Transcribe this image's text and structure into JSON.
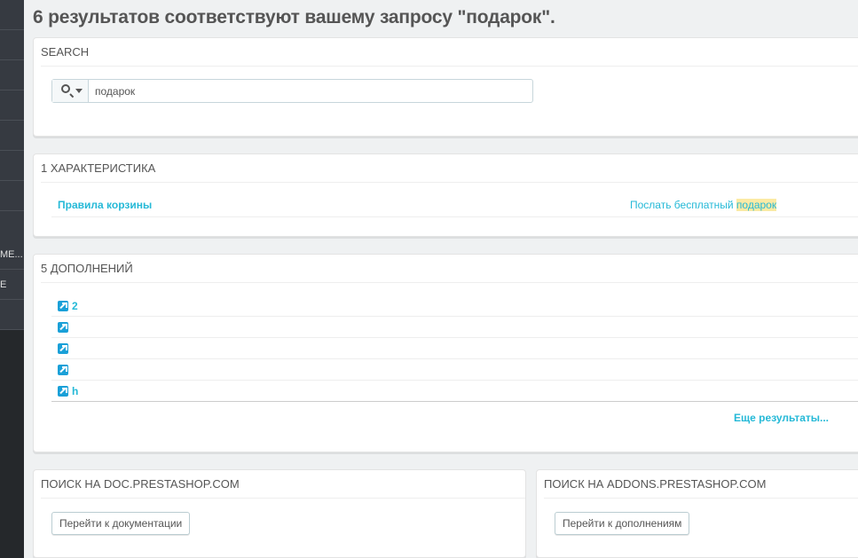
{
  "sidebar": {
    "items": [
      {
        "label": ""
      },
      {
        "label": ""
      },
      {
        "label": ""
      },
      {
        "label": ""
      },
      {
        "label": ""
      },
      {
        "label": ""
      },
      {
        "label": ""
      },
      {
        "label": "МЕ..."
      },
      {
        "label": "Е"
      },
      {
        "label": ""
      }
    ]
  },
  "page_title": "6 результатов соответствуют вашему запросу \"подарок\".",
  "search_panel": {
    "heading": "SEARCH",
    "query": "подарок"
  },
  "features_panel": {
    "heading": "1 ХАРАКТЕРИСТИКА",
    "rows": [
      {
        "name": "Правила корзины",
        "desc_prefix": "Послать бесплатный ",
        "desc_highlight": "подарок"
      }
    ]
  },
  "addons_panel": {
    "heading": "5 ДОПОЛНЕНИЙ",
    "rows": [
      {
        "label": "2"
      },
      {
        "label": ""
      },
      {
        "label": ""
      },
      {
        "label": ""
      },
      {
        "label": "h"
      }
    ],
    "more_results": "Еще результаты..."
  },
  "doc_panel": {
    "heading": "ПОИСК НА DOC.PRESTASHOP.COM",
    "button": "Перейти к документации"
  },
  "addons_site_panel": {
    "heading": "ПОИСК НА ADDONS.PRESTASHOP.COM",
    "button": "Перейти к дополнениям"
  },
  "colors": {
    "accent": "#25b9d7",
    "sidebar_bg": "#363a41",
    "highlight": "#fbeaa5"
  }
}
